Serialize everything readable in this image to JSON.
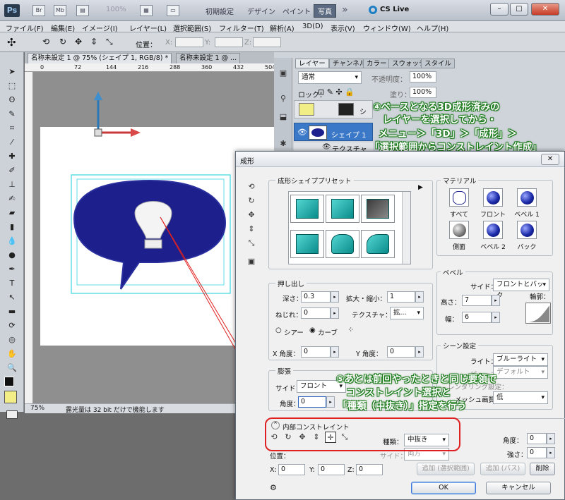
{
  "app": {
    "logo": "Ps",
    "zoom_display": "100%",
    "workspaces": [
      "初期設定",
      "デザイン",
      "ペイント",
      "写真"
    ],
    "active_workspace": "写真",
    "cs_live": "CS Live"
  },
  "menu": [
    "ファイル(F)",
    "編集(E)",
    "イメージ(I)",
    "レイヤー(L)",
    "選択範囲(S)",
    "フィルター(T)",
    "解析(A)",
    "3D(D)",
    "表示(V)",
    "ウィンドウ(W)",
    "ヘルプ(H)"
  ],
  "options_bar": {
    "position_label": "位置：",
    "x_label": "X:",
    "y_label": "Y:",
    "z_label": "Z:"
  },
  "document": {
    "tab1": "名称未設定 1 @ 75% (シェイプ 1, RGB/8) *",
    "tab2": "名称未設定 1 @ ...",
    "ruler_ticks": [
      "0",
      "72",
      "144",
      "216",
      "288",
      "360",
      "432",
      "504"
    ],
    "status_zoom": "75%",
    "status_text": "露光量は 32 bit だけで機能します"
  },
  "layers_panel": {
    "tabs": [
      "レイヤー",
      "チャンネル",
      "カラー",
      "スウォッチ",
      "スタイル"
    ],
    "blend_mode": "通常",
    "opacity_label": "不透明度：",
    "opacity": "100%",
    "lock_label": "ロック：",
    "fill_label": "塗り：",
    "fill": "100%",
    "layer_shape": "シェイプ 1",
    "layer_texture": "テクスチャ",
    "layer_short": "シ"
  },
  "annotation4": {
    "line1": "④ベースとなる3D成形済みの",
    "line2": "レイヤーを選択してから・",
    "line3": "メニュー＞「3D」＞「成形」＞",
    "line4": "「選択範囲からコンストレイント作成」"
  },
  "annotation5": {
    "line1": "⑤あとは前回やったときと同じ要領で",
    "line2": "コンストレイント選択と",
    "line3": "「種類（中抜き）」指定を行う"
  },
  "dialog": {
    "title": "成形",
    "close": "✕",
    "preset_group": "成形シェイププリセット",
    "material_group": "マテリアル",
    "materials": [
      "すべて",
      "フロント",
      "ベベル 1",
      "側面",
      "ベベル 2",
      "バック"
    ],
    "extrusion_group": "押し出し",
    "depth_label": "深さ：",
    "depth": "0.3",
    "scale_label": "拡大・縮小：",
    "scale": "1",
    "twist_label": "ねじれ：",
    "twist": "0",
    "texture_label": "テクスチャ：",
    "texture": "拡...",
    "shear_label": "シアー",
    "bend_label": "カーブ",
    "xangle_label": "X 角度：",
    "xangle": "0",
    "yangle_label": "Y 角度：",
    "yangle": "0",
    "bevel_group": "ベベル",
    "side_label": "サイド：",
    "bevel_side": "フロントとバック",
    "height_label": "高さ：",
    "height": "7",
    "contour_label": "輪郭：",
    "width_label": "幅：",
    "width": "6",
    "inflate_group": "膨張",
    "inflate_side_label": "サイド：",
    "inflate_side": "フロント",
    "inflate_angle_label": "角度：",
    "inflate_angle": "0",
    "scene_group": "シーン設定",
    "light_label": "ライト：",
    "light": "ブルーライト",
    "view_label": "ビュー：",
    "view": "デフォルト",
    "render_label": "レンダリング設定：",
    "mesh_label": "メッシュ画質：",
    "mesh": "低",
    "internal_group": "内部コンストレイント",
    "type_label": "種類：",
    "type": "中抜き",
    "constraint_side_label": "サイド：",
    "constraint_side": "両方",
    "angle_label": "角度：",
    "angle": "0",
    "strength_label": "強さ：",
    "strength": "0",
    "position_label": "位置：",
    "x_label": "X:",
    "x": "0",
    "y_label": "Y:",
    "y": "0",
    "z_label": "Z:",
    "z": "0",
    "add_selection": "追加 (選択範囲)",
    "add_path": "追加 (パス)",
    "delete": "削除",
    "ok": "OK",
    "cancel": "キャンセル"
  },
  "colors": {
    "shape": "#1c1f8c",
    "annotation_green": "#1a7a1a",
    "constraint_red": "#e02020"
  }
}
